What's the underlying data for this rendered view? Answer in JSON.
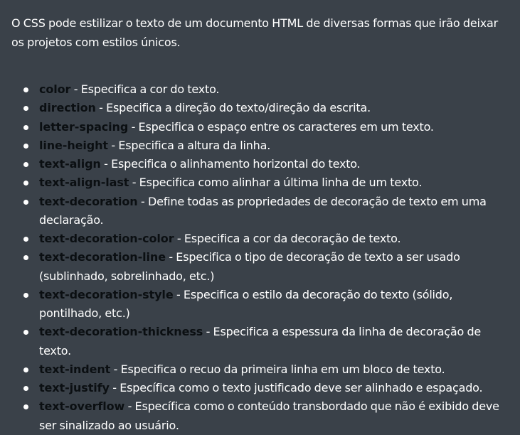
{
  "intro": "O CSS pode estilizar o texto de um documento HTML de diversas formas que irão deixar os projetos com estilos únicos.",
  "properties": [
    {
      "name": "color",
      "desc": " - Especifica a cor do texto."
    },
    {
      "name": "direction",
      "desc": " - Especifica a direção do texto/direção da escrita."
    },
    {
      "name": "letter-spacing",
      "desc": " - Especifica o espaço entre os caracteres em um texto."
    },
    {
      "name": "line-height",
      "desc": " - Especifica a altura da linha."
    },
    {
      "name": "text-align",
      "desc": " - Especifica o alinhamento horizontal do texto."
    },
    {
      "name": "text-align-last",
      "desc": " - Especifica como alinhar a última linha de um texto."
    },
    {
      "name": "text-decoration",
      "desc": " - Define todas as propriedades de decoração de texto em uma declaração."
    },
    {
      "name": "text-decoration-color",
      "desc": " - Especifica a cor da decoração de texto."
    },
    {
      "name": "text-decoration-line",
      "desc": " - Especifica o tipo de decoração de texto a ser usado (sublinhado, sobrelinhado, etc.)"
    },
    {
      "name": "text-decoration-style",
      "desc": " - Especifica o estilo da decoração do texto (sólido, pontilhado, etc.)"
    },
    {
      "name": "text-decoration-thickness",
      "desc": " - Especifica a espessura da linha de decoração de texto."
    },
    {
      "name": "text-indent",
      "desc": " - Especifica o recuo da primeira linha em um bloco de texto."
    },
    {
      "name": "text-justify",
      "desc": " - Específica como o texto justificado deve ser alinhado e espaçado."
    },
    {
      "name": "text-overflow",
      "desc": " - Específica como o conteúdo transbordado que não é exibido deve ser sinalizado ao usuário."
    }
  ],
  "colors": {
    "background": "#3a4149",
    "text": "#ffffff",
    "property_name": "#0b0f12"
  }
}
